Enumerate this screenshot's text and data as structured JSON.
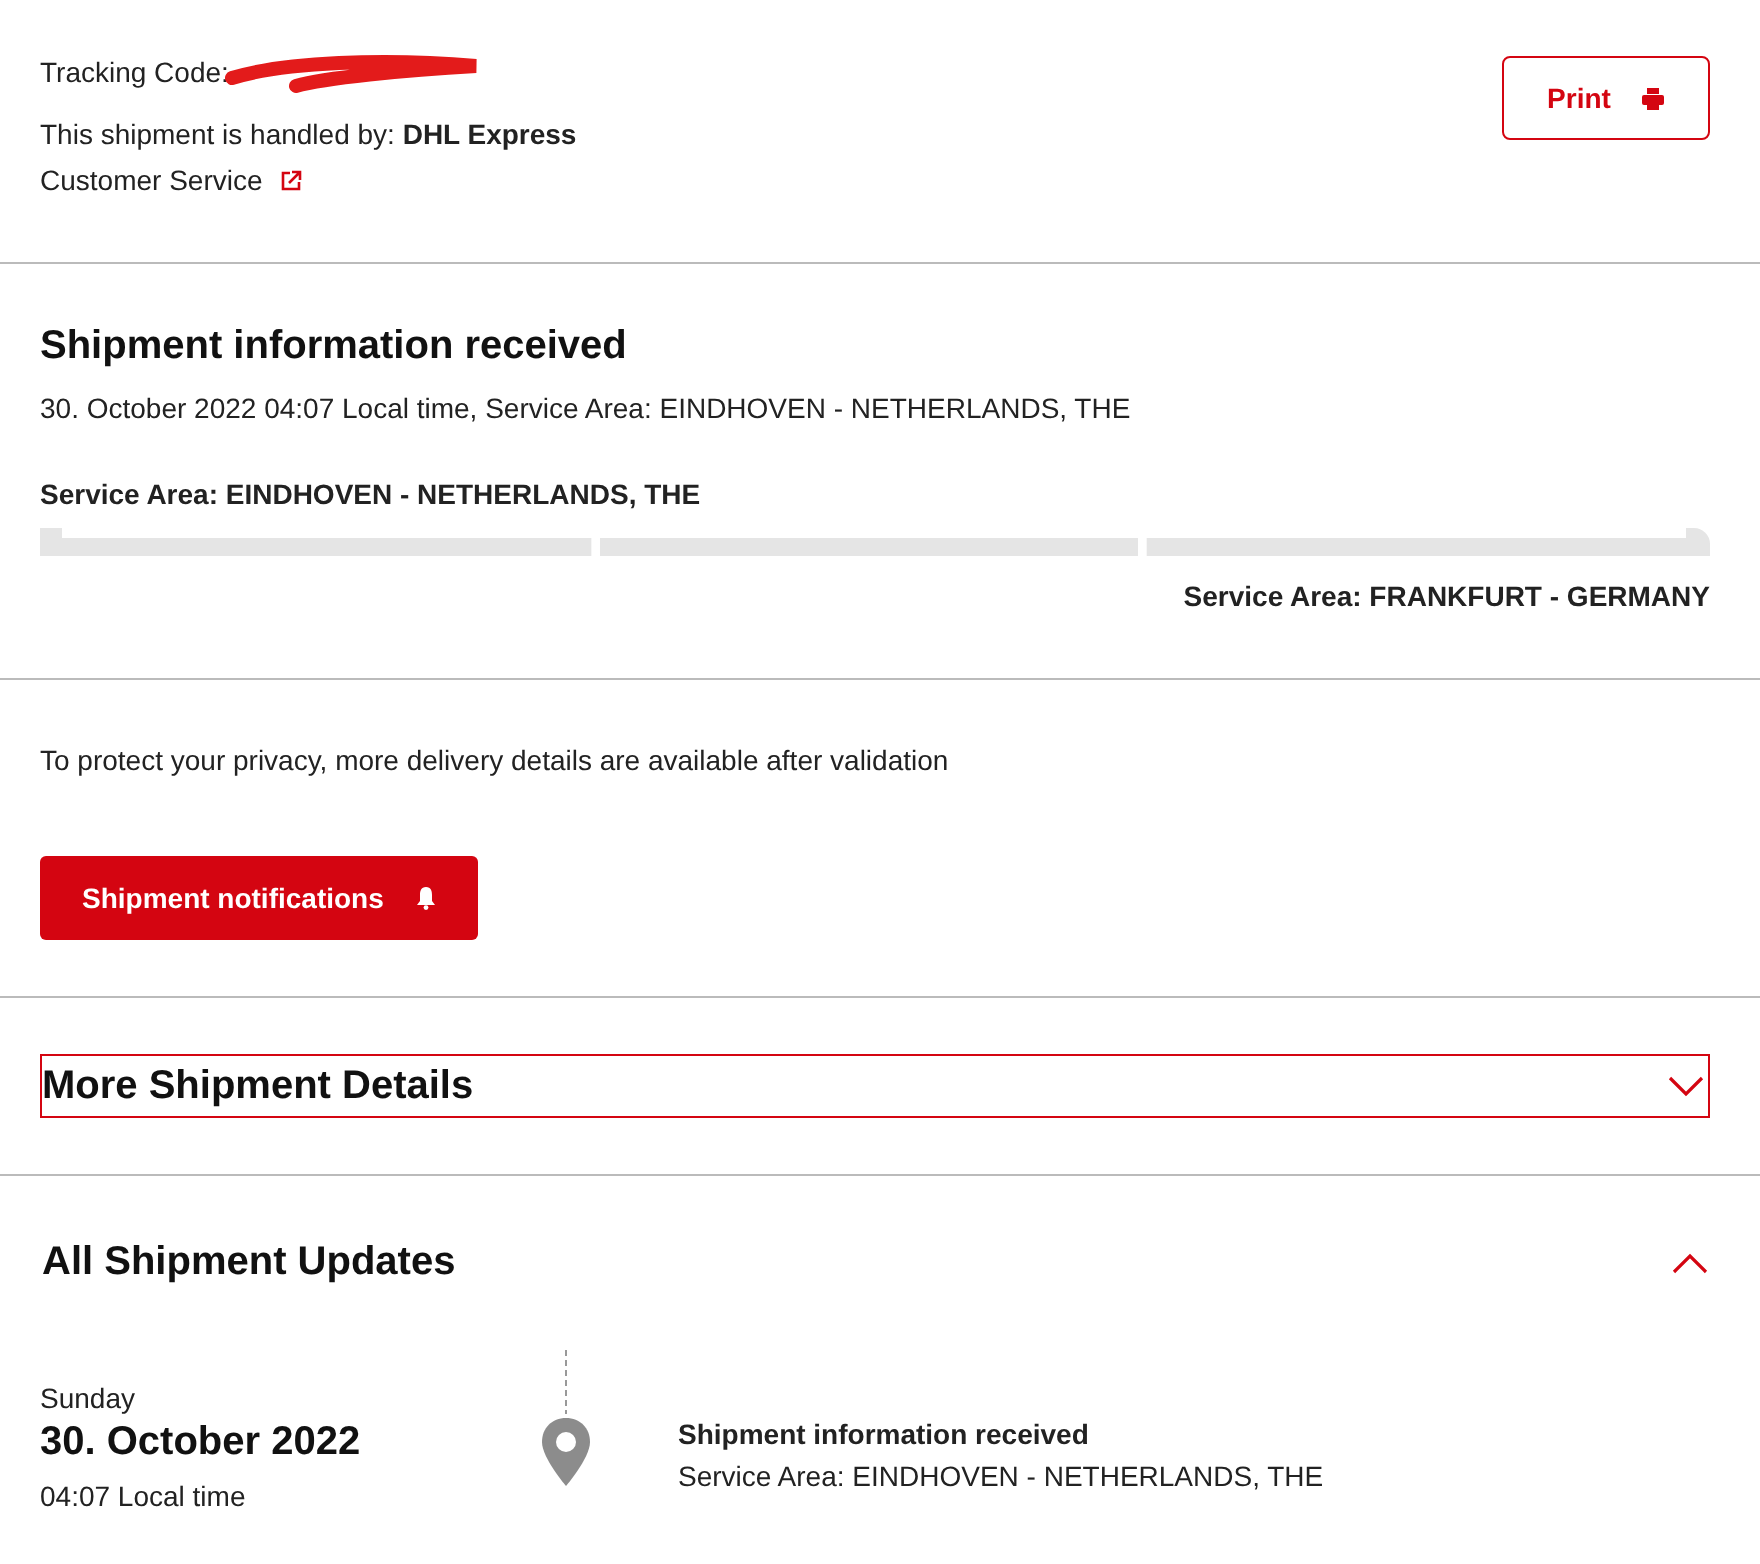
{
  "header": {
    "tracking_label": "Tracking Code:",
    "handled_by": "This shipment is handled by: **DHL Express**",
    "customer_service": "Customer Service",
    "print_button": "Print"
  },
  "status": {
    "title": "Shipment information received",
    "detail": "30. October 2022 04:07 Local time, Service Area: EINDHOVEN - NETHERLANDS, THE",
    "origin": "Service Area: EINDHOVEN - NETHERLANDS, THE",
    "destination": "Service Area: FRANKFURT - GERMANY"
  },
  "privacy": {
    "text": "To protect your privacy, more delivery details are available after validation",
    "button": "Shipment notifications"
  },
  "sections": [
    {
      "title": "More Shipment Details",
      "expanded": false,
      "focused": true
    },
    {
      "title": "All Shipment Updates",
      "expanded": true,
      "focused": false
    }
  ],
  "updates": [
    {
      "weekday": "Sunday",
      "date": "30. October 2022",
      "time": "04:07 Local time",
      "event": "Shipment information received",
      "location": "Service Area: EINDHOVEN - NETHERLANDS, THE"
    }
  ]
}
